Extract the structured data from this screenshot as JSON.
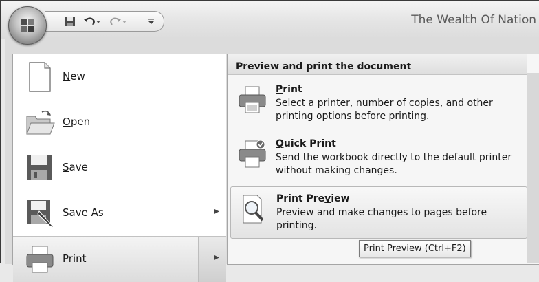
{
  "window": {
    "title": "The Wealth Of Nation"
  },
  "qat": {
    "save": "save-icon",
    "undo": "undo-icon",
    "redo": "redo-icon",
    "customize": "customize-qat-icon"
  },
  "menu": {
    "items": [
      {
        "label_pre": "",
        "label_key": "N",
        "label_post": "ew",
        "icon": "new-document-icon",
        "has_submenu": false
      },
      {
        "label_pre": "",
        "label_key": "O",
        "label_post": "pen",
        "icon": "open-folder-icon",
        "has_submenu": false
      },
      {
        "label_pre": "",
        "label_key": "S",
        "label_post": "ave",
        "icon": "save-disk-icon",
        "has_submenu": false
      },
      {
        "label_pre": "Save ",
        "label_key": "A",
        "label_post": "s",
        "icon": "save-as-icon",
        "has_submenu": true
      },
      {
        "label_pre": "",
        "label_key": "P",
        "label_post": "rint",
        "icon": "printer-icon",
        "has_submenu": true
      }
    ]
  },
  "submenu": {
    "header": "Preview and print the document",
    "items": [
      {
        "title_pre": "",
        "title_key": "P",
        "title_post": "rint",
        "desc": "Select a printer, number of copies, and other printing options before printing."
      },
      {
        "title_pre": "",
        "title_key": "Q",
        "title_post": "uick Print",
        "desc": "Send the workbook directly to the default printer without making changes."
      },
      {
        "title_pre": "Print Pre",
        "title_key": "v",
        "title_post": "iew",
        "desc": "Preview and make changes to pages before printing."
      }
    ]
  },
  "tooltip": {
    "text": "Print Preview (Ctrl+F2)"
  }
}
